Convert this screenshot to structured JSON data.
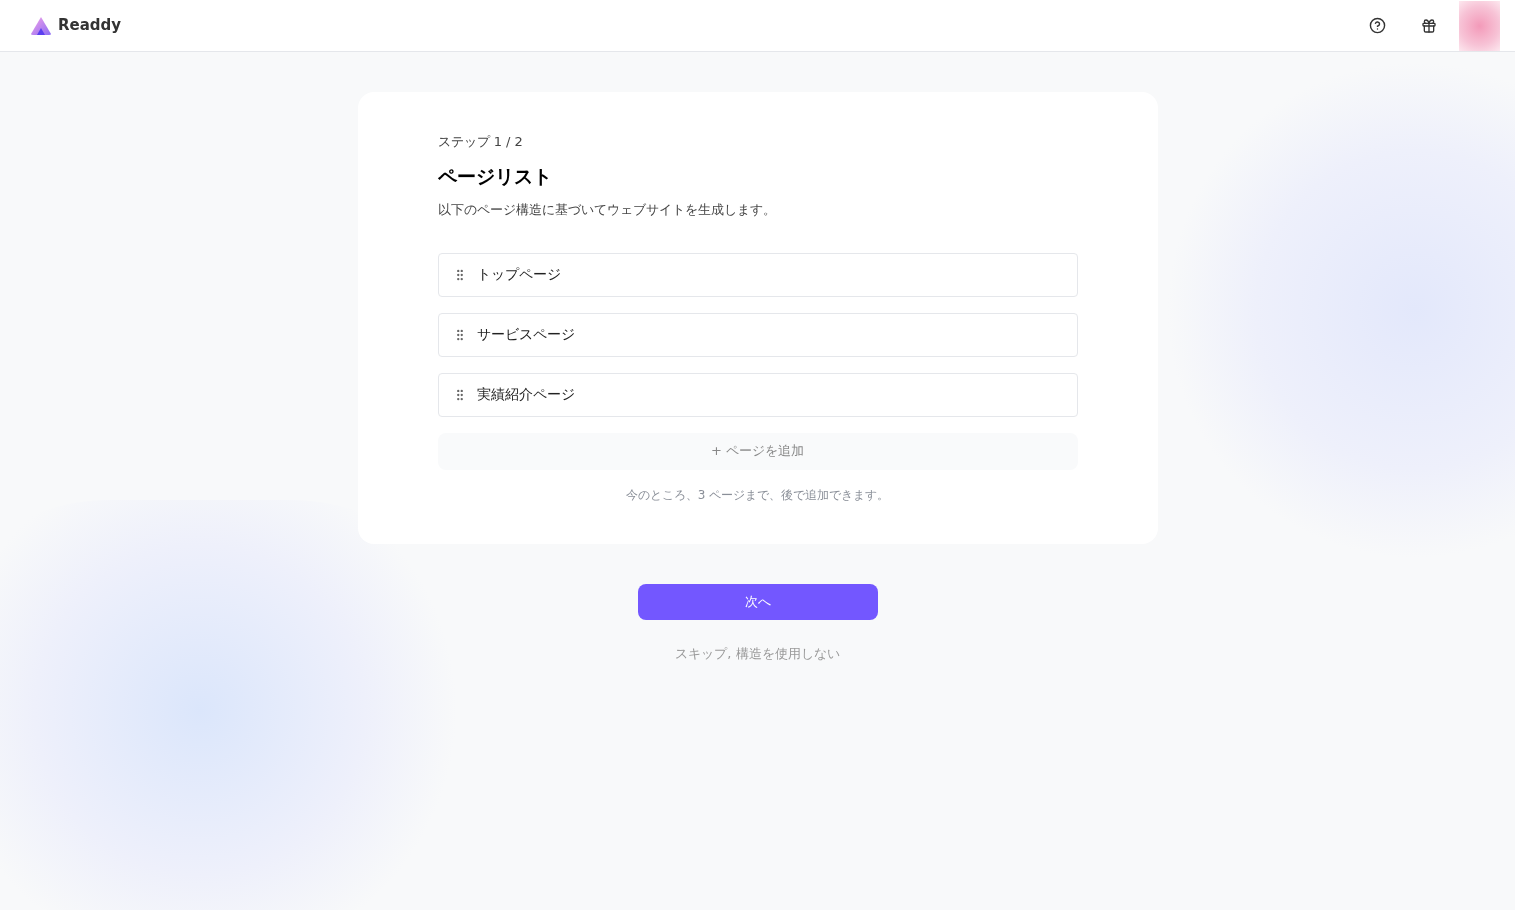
{
  "header": {
    "brand": "Readdy"
  },
  "card": {
    "step": "ステップ 1 / 2",
    "title": "ページリスト",
    "description": "以下のページ構造に基づいてウェブサイトを生成します。",
    "pages": [
      {
        "label": "トップページ"
      },
      {
        "label": "サービスページ"
      },
      {
        "label": "実績紹介ページ"
      }
    ],
    "add_button": "+ ページを追加",
    "note": "今のところ、3 ページまで、後で追加できます。"
  },
  "next_button": "次へ",
  "skip_link": "スキップ, 構造を使用しない"
}
